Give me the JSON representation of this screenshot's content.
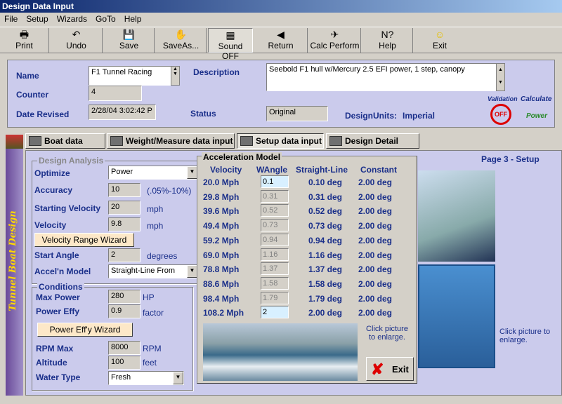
{
  "window": {
    "title": "Design Data Input"
  },
  "menu": [
    "File",
    "Setup",
    "Wizards",
    "GoTo",
    "Help"
  ],
  "toolbar": [
    "Print",
    "Undo",
    "Save",
    "SaveAs...",
    "Sound OFF",
    "Return",
    "Calc Perform",
    "Help",
    "Exit"
  ],
  "header": {
    "name_label": "Name",
    "name_value": "F1 Tunnel Racing",
    "counter_label": "Counter",
    "counter_value": "4",
    "date_label": "Date Revised",
    "date_value": "2/28/04 3:02:42 P",
    "description_label": "Description",
    "description_value": "Seebold F1 hull w/Mercury 2.5 EFI power, 1 step, canopy",
    "status_label": "Status",
    "status_value": "Original",
    "units_label": "DesignUnits:",
    "units_value": "Imperial",
    "validation": "Validation",
    "validation_off": "OFF",
    "calculate": "Calculate",
    "power": "Power"
  },
  "tabs": [
    "Boat data input",
    "Weight/Measure data input",
    "Setup data input",
    "Design Detail input"
  ],
  "sidebar_title": "Tunnel Boat Design",
  "page_title": "Page 3 - Setup",
  "design_analysis": {
    "title": "Design Analysis",
    "optimize_label": "Optimize",
    "optimize_value": "Power",
    "accuracy_label": "Accuracy",
    "accuracy_value": "10",
    "accuracy_unit": "(.05%-10%)",
    "start_vel_label": "Starting Velocity",
    "start_vel_value": "20",
    "start_vel_unit": "mph",
    "velocity_label": "Velocity",
    "velocity_value": "9.8",
    "velocity_unit": "mph",
    "vrw_button": "Velocity Range Wizard",
    "start_angle_label": "Start Angle",
    "start_angle_value": "2",
    "start_angle_unit": "degrees",
    "accel_model_label": "Accel'n Model",
    "accel_model_value": "Straight-Line From"
  },
  "conditions": {
    "title": "Conditions",
    "max_power_label": "Max Power",
    "max_power_value": "280",
    "max_power_unit": "HP",
    "power_effy_label": "Power Effy",
    "power_effy_value": "0.9",
    "power_effy_unit": "factor",
    "pew_button": "Power Eff'y Wizard",
    "rpm_label": "RPM Max",
    "rpm_value": "8000",
    "rpm_unit": "RPM",
    "altitude_label": "Altitude",
    "altitude_value": "100",
    "altitude_unit": "feet",
    "water_label": "Water Type",
    "water_value": "Fresh"
  },
  "accel": {
    "title": "Acceleration Model",
    "headers": [
      "Velocity",
      "WAngle",
      "Straight-Line",
      "Constant"
    ],
    "rows": [
      {
        "v": "20.0 Mph",
        "w": "0.1",
        "s": "0.10 deg",
        "c": "2.00 deg"
      },
      {
        "v": "29.8 Mph",
        "w": "0.31",
        "s": "0.31 deg",
        "c": "2.00 deg"
      },
      {
        "v": "39.6 Mph",
        "w": "0.52",
        "s": "0.52 deg",
        "c": "2.00 deg"
      },
      {
        "v": "49.4 Mph",
        "w": "0.73",
        "s": "0.73 deg",
        "c": "2.00 deg"
      },
      {
        "v": "59.2 Mph",
        "w": "0.94",
        "s": "0.94 deg",
        "c": "2.00 deg"
      },
      {
        "v": "69.0 Mph",
        "w": "1.16",
        "s": "1.16 deg",
        "c": "2.00 deg"
      },
      {
        "v": "78.8 Mph",
        "w": "1.37",
        "s": "1.37 deg",
        "c": "2.00 deg"
      },
      {
        "v": "88.6 Mph",
        "w": "1.58",
        "s": "1.58 deg",
        "c": "2.00 deg"
      },
      {
        "v": "98.4 Mph",
        "w": "1.79",
        "s": "1.79 deg",
        "c": "2.00 deg"
      },
      {
        "v": "108.2 Mph",
        "w": "2",
        "s": "2.00 deg",
        "c": "2.00 deg"
      }
    ],
    "click_hint": "Click picture to enlarge.",
    "exit_label": "Exit"
  },
  "right_hint": "Click picture to enlarge."
}
